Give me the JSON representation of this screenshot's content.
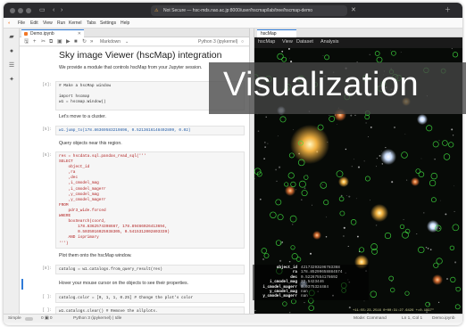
{
  "browser": {
    "tab_title": "Not Secure — hsc-mds.nao.ac.jp:8000/user/hscmap/lab/tree/hscmap-demo",
    "warn_icon": "warning-icon",
    "close_icon": "close-icon",
    "plus_icon": "plus-icon"
  },
  "menu": [
    "File",
    "Edit",
    "View",
    "Run",
    "Kernel",
    "Tabs",
    "Settings",
    "Help"
  ],
  "left_sidebar": [
    "folder-icon",
    "running-icon",
    "commands-icon",
    "tabs-icon"
  ],
  "notebook": {
    "tab_label": "Demo.ipynb",
    "toolbar": {
      "cell_type": "Markdown",
      "kernel": "Python 3 (ipykernel)"
    },
    "title": "Sky image Viewer (hscMap) integration",
    "intro": "We provide a module that controls hscMap from your Jupyter session.",
    "cells": [
      {
        "prompt": "[4]:",
        "code": "# Make a hscMap window\n\nimport hscmap\nw1 = hscmap.Window()"
      },
      {
        "markdown": "Let's move to a cluster."
      },
      {
        "prompt": "[5]:",
        "code": "w1.jump_to(178.86369583219896, 0.5213616148402809, 0.02)"
      },
      {
        "markdown": "Query objects near this region."
      },
      {
        "prompt": "[6]:",
        "code": "res = hscdata.sql.pandas_read_sql('''\nSELECT\n    object_id\n    ,ra\n    ,dec\n    ,i_cmodel_mag\n    ,i_cmodel_magerr\n    ,y_cmodel_mag\n    ,y_cmodel_magerr\nFROM\n    pdr3_wide.forced\nWHERE\n    boxSearch(coord,\n        178.8362574398667, 178.89466026413694,\n        0.5035016025938305, 0.5415312002803339)\n    AND isprimary\n''')"
      },
      {
        "markdown": "Plot them onto the hscMap window."
      },
      {
        "prompt": "[8]:",
        "code": "catalog = w1.catalogs.from_query_result(res)"
      },
      {
        "markdown": "Hover your mouse cursor on the objects to see their properties."
      },
      {
        "prompt": "[ ]:",
        "code": "catalog.color = [0, 1, 1, 0.25] # Change the plot's color"
      },
      {
        "prompt": "[ ]:",
        "code": "w1.catalogs.clear() # Remove the allplots."
      }
    ]
  },
  "viewer": {
    "tab_label": "hscMap",
    "menu": [
      "hscMap",
      "View",
      "Dataset",
      "Analysis"
    ],
    "info": [
      {
        "key": "object_id",
        "value": "42173293196783368"
      },
      {
        "key": "ra",
        "value": "178.85299658884574"
      },
      {
        "key": "dec",
        "value": "0.52267554178692"
      },
      {
        "key": "i_cmodel_mag",
        "value": "22.5423446"
      },
      {
        "key": "i_cmodel_magerr",
        "value": "0.0375324484"
      },
      {
        "key": "y_cmodel_mag",
        "value": "nan"
      },
      {
        "key": "y_cmodel_magerr",
        "value": "nan"
      }
    ],
    "coordinates": "+11:55:23.2516 0+00:31:27.6426 +=0.1997\""
  },
  "overlay_text": "Visualization",
  "statusbar": {
    "mode": "Simple",
    "counts": "0 ▣ 0",
    "kernel": "Python 3 (ipykernel) | Idle",
    "command": "Mode: Command",
    "position": "Ln 1, Col 1",
    "file": "Demo.ipynb"
  }
}
